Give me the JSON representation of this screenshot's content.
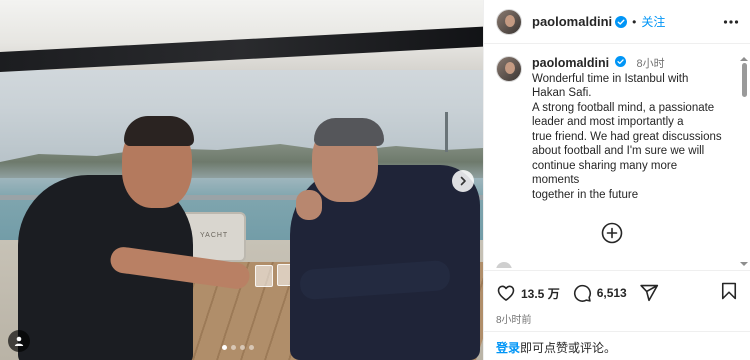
{
  "photo": {
    "chair_label": "YACHT",
    "carousel": {
      "total": 4,
      "active_index": 0
    }
  },
  "header": {
    "username": "paolomaldini",
    "separator": "•",
    "follow_label": "关注"
  },
  "caption": {
    "username": "paolomaldini",
    "time": "8小时",
    "lines": [
      "Wonderful time in Istanbul with",
      "Hakan Safi.",
      "A strong football mind, a passionate",
      "leader and most importantly a",
      "true friend. We had great discussions",
      "about football and I'm sure we will",
      "continue sharing many more",
      "moments",
      "together in the future"
    ]
  },
  "actions": {
    "likes": "13.5 万",
    "comments": "6,513",
    "post_time": "8小时前"
  },
  "login": {
    "link": "登录",
    "rest": "即可点赞或评论。"
  },
  "colors": {
    "accent": "#0095f6",
    "text": "#262626",
    "muted": "#737373",
    "border": "#efefef"
  },
  "icons": {
    "verified": "verified-badge-icon",
    "more": "more-horizontal-icon",
    "heart": "heart-icon",
    "comment": "comment-icon",
    "share": "share-icon",
    "bookmark": "bookmark-icon",
    "load_more": "plus-circle-icon",
    "next": "chevron-right-icon",
    "user_tag": "user-tag-icon"
  }
}
